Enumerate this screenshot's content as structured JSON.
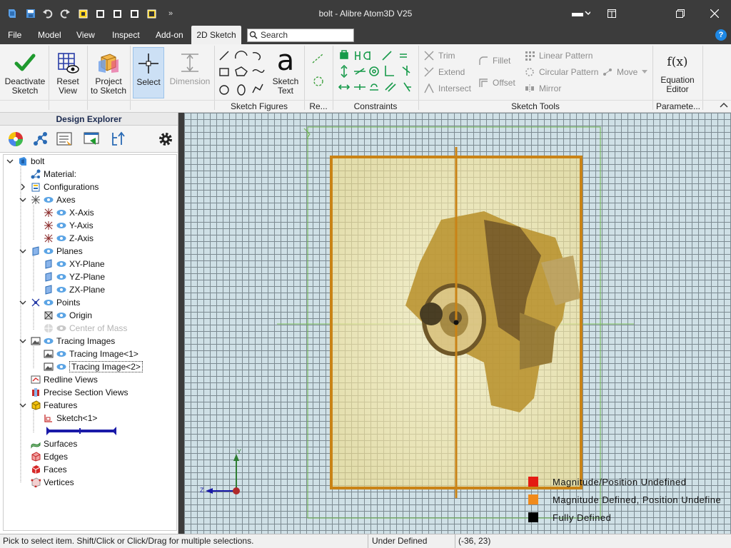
{
  "window": {
    "title": "bolt - Alibre Atom3D V25"
  },
  "menu": {
    "items": [
      "File",
      "Model",
      "View",
      "Inspect",
      "Add-on"
    ],
    "active_tab": "2D Sketch",
    "search_placeholder": "Search"
  },
  "ribbon": {
    "buttons": {
      "deactivate_line1": "Deactivate",
      "deactivate_line2": "Sketch",
      "reset_line1": "Reset",
      "reset_line2": "View",
      "project_line1": "Project",
      "project_line2": "to Sketch",
      "select": "Select",
      "dimension": "Dimension",
      "sketch_text_line1": "Sketch",
      "sketch_text_line2": "Text"
    },
    "tools": {
      "trim": "Trim",
      "extend": "Extend",
      "intersect": "Intersect",
      "fillet": "Fillet",
      "offset": "Offset",
      "linear_pattern": "Linear Pattern",
      "circular_pattern": "Circular Pattern",
      "mirror": "Mirror",
      "move": "Move",
      "equation_icon": "f(x)",
      "equation_line1": "Equation",
      "equation_line2": "Editor"
    },
    "groups": {
      "sketch_figures": "Sketch Figures",
      "re": "Re...",
      "constraints": "Constraints",
      "sketch_tools": "Sketch Tools",
      "parameters": "Paramete..."
    }
  },
  "explorer": {
    "title": "Design Explorer",
    "tree": {
      "root": "bolt",
      "material": "Material:",
      "configurations": "Configurations",
      "axes": "Axes",
      "x_axis": "X-Axis",
      "y_axis": "Y-Axis",
      "z_axis": "Z-Axis",
      "planes": "Planes",
      "xy_plane": "XY-Plane",
      "yz_plane": "YZ-Plane",
      "zx_plane": "ZX-Plane",
      "points": "Points",
      "origin": "Origin",
      "center_of_mass": "Center of Mass",
      "tracing_images": "Tracing Images",
      "tracing_image_1": "Tracing Image<1>",
      "tracing_image_2": "Tracing Image<2>",
      "redline_views": "Redline Views",
      "precise_section_views": "Precise Section Views",
      "features": "Features",
      "sketch_1": "Sketch<1>",
      "surfaces": "Surfaces",
      "edges": "Edges",
      "faces": "Faces",
      "vertices": "Vertices"
    }
  },
  "canvas": {
    "triad": {
      "y_label": "Y",
      "z_label": "Z"
    },
    "legend": [
      {
        "label": "Magnitude/Position Undefined",
        "color": "#e41b13"
      },
      {
        "label": "Magnitude Defined, Position Undefine",
        "color": "#f08a1c"
      },
      {
        "label": "Fully Defined",
        "color": "#000000"
      }
    ]
  },
  "status": {
    "hint": "Pick to select item. Shift/Click or Click/Drag for multiple selections.",
    "state": "Under Defined",
    "coords": "(-36, 23)"
  },
  "colors": {
    "chrome": "#3c3c3c",
    "ribbon": "#f3f3f3",
    "accent": "#1e88e5",
    "sketch_orange": "#c98316"
  }
}
